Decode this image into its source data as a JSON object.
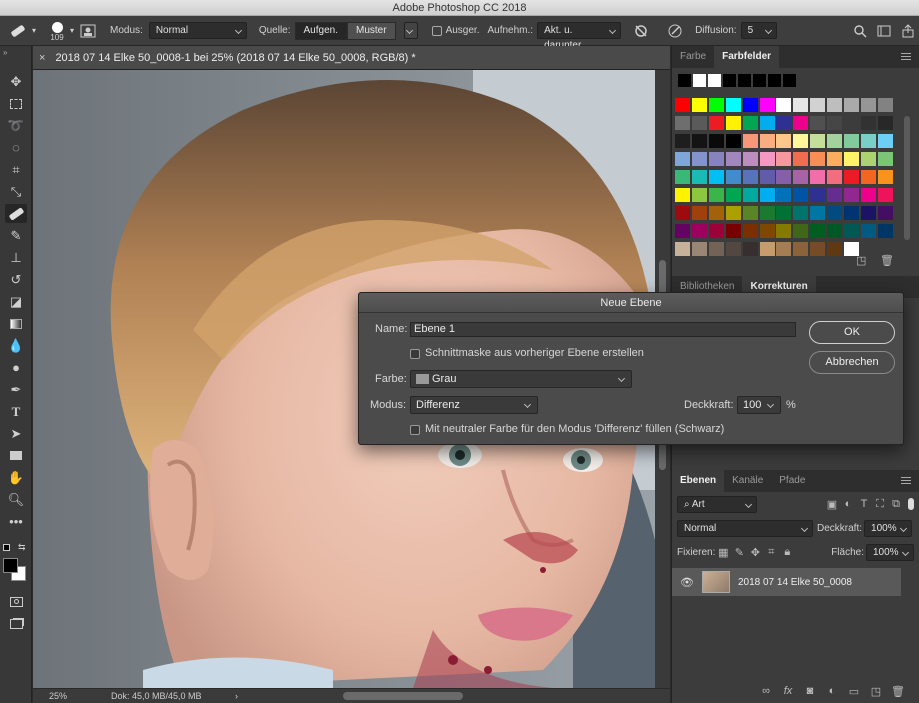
{
  "window": {
    "title": "Adobe Photoshop CC 2018"
  },
  "options": {
    "brush_size": "109",
    "mode_label": "Modus:",
    "mode_value": "Normal",
    "source_label": "Quelle:",
    "source_sampled": "Aufgen.",
    "source_pattern": "Muster",
    "aligned_label": "Ausger.",
    "sample_label": "Aufnehm.:",
    "sample_value": "Akt. u. darunter",
    "diffusion_label": "Diffusion:",
    "diffusion_value": "5"
  },
  "document": {
    "tab_title": "2018 07 14 Elke 50_0008-1 bei 25% (2018 07 14 Elke 50_0008, RGB/8) *",
    "zoom": "25%",
    "doc_info": "Dok: 45,0 MB/45,0 MB"
  },
  "panels": {
    "color_tabs": [
      "Farbe",
      "Farbfelder"
    ],
    "mid_tabs": [
      "Bibliotheken",
      "Korrekturen"
    ],
    "layer_tabs": [
      "Ebenen",
      "Kanäle",
      "Pfade"
    ],
    "filter_label": "Art",
    "blend_mode": "Normal",
    "opacity_label": "Deckkraft:",
    "opacity_value": "100%",
    "lock_label": "Fixieren:",
    "fill_label": "Fläche:",
    "fill_value": "100%",
    "layer_name": "2018 07 14 Elke 50_0008"
  },
  "swatches": {
    "recent": [
      "#000000",
      "#ffffff",
      "#ffffff",
      "#000000",
      "#000000",
      "#000000",
      "#000000",
      "#000000"
    ],
    "grid": [
      [
        "#ff0000",
        "#ffff00",
        "#00ff00",
        "#00ffff",
        "#0000ff",
        "#ff00ff",
        "#ffffff",
        "#e6e6e6",
        "#d2d2d2",
        "#bebebe",
        "#aaaaaa",
        "#969696",
        "#828282"
      ],
      [
        "#6e6e6e",
        "#5a5a5a",
        "#ed1c24",
        "#fff200",
        "#00a651",
        "#00aeef",
        "#2e3192",
        "#ec008c",
        "#505050",
        "#464646",
        "#3c3c3c",
        "#323232",
        "#282828"
      ],
      [
        "#1e1e1e",
        "#141414",
        "#0a0a0a",
        "#000000",
        "#f7977a",
        "#f9ad81",
        "#fdc68a",
        "#fff79a",
        "#c4df9b",
        "#a2d39c",
        "#82ca9d",
        "#7bcdc8",
        "#6ecff6"
      ],
      [
        "#7ea7d8",
        "#8493ca",
        "#8882be",
        "#a187be",
        "#bc8dbf",
        "#f49ac2",
        "#f6989d",
        "#f26c4f",
        "#f68e55",
        "#fbaf5c",
        "#fff467",
        "#acd372",
        "#7cc576"
      ],
      [
        "#3bb878",
        "#1abbb4",
        "#00bff3",
        "#438ccb",
        "#5574b9",
        "#605ca8",
        "#855fa8",
        "#a763a8",
        "#f06eaa",
        "#f26d7d",
        "#ed1c24",
        "#f26522",
        "#f7941d"
      ],
      [
        "#fff200",
        "#8dc63f",
        "#39b54a",
        "#00a651",
        "#00a99d",
        "#00aeef",
        "#0072bc",
        "#0054a6",
        "#2e3192",
        "#662d91",
        "#92278f",
        "#ec008c",
        "#ed145b"
      ],
      [
        "#9e0b0f",
        "#a0410d",
        "#a36209",
        "#aba000",
        "#598527",
        "#1a7b30",
        "#007236",
        "#00746b",
        "#0076a3",
        "#004b80",
        "#003471",
        "#1b1464",
        "#440e62"
      ],
      [
        "#630460",
        "#9e005d",
        "#9e0039",
        "#790000",
        "#7b2e00",
        "#7d4900",
        "#827b00",
        "#406618",
        "#005e20",
        "#005826",
        "#005952",
        "#005b7f",
        "#003663"
      ],
      [
        "#c7b299",
        "#998675",
        "#736357",
        "#534741",
        "#362f2d",
        "#c69c6d",
        "#a67c52",
        "#8c6239",
        "#754c24",
        "#603913",
        "#ffffff",
        "",
        ""
      ]
    ]
  },
  "dialog": {
    "title": "Neue Ebene",
    "name_label": "Name:",
    "name_value": "Ebene 1",
    "clip_label": "Schnittmaske aus vorheriger Ebene erstellen",
    "color_label": "Farbe:",
    "color_value": "Grau",
    "mode_label": "Modus:",
    "mode_value": "Differenz",
    "opacity_label": "Deckkraft:",
    "opacity_value": "100",
    "opacity_unit": "%",
    "fill_label": "Mit neutraler Farbe für den Modus 'Differenz' füllen (Schwarz)",
    "ok": "OK",
    "cancel": "Abbrechen"
  }
}
